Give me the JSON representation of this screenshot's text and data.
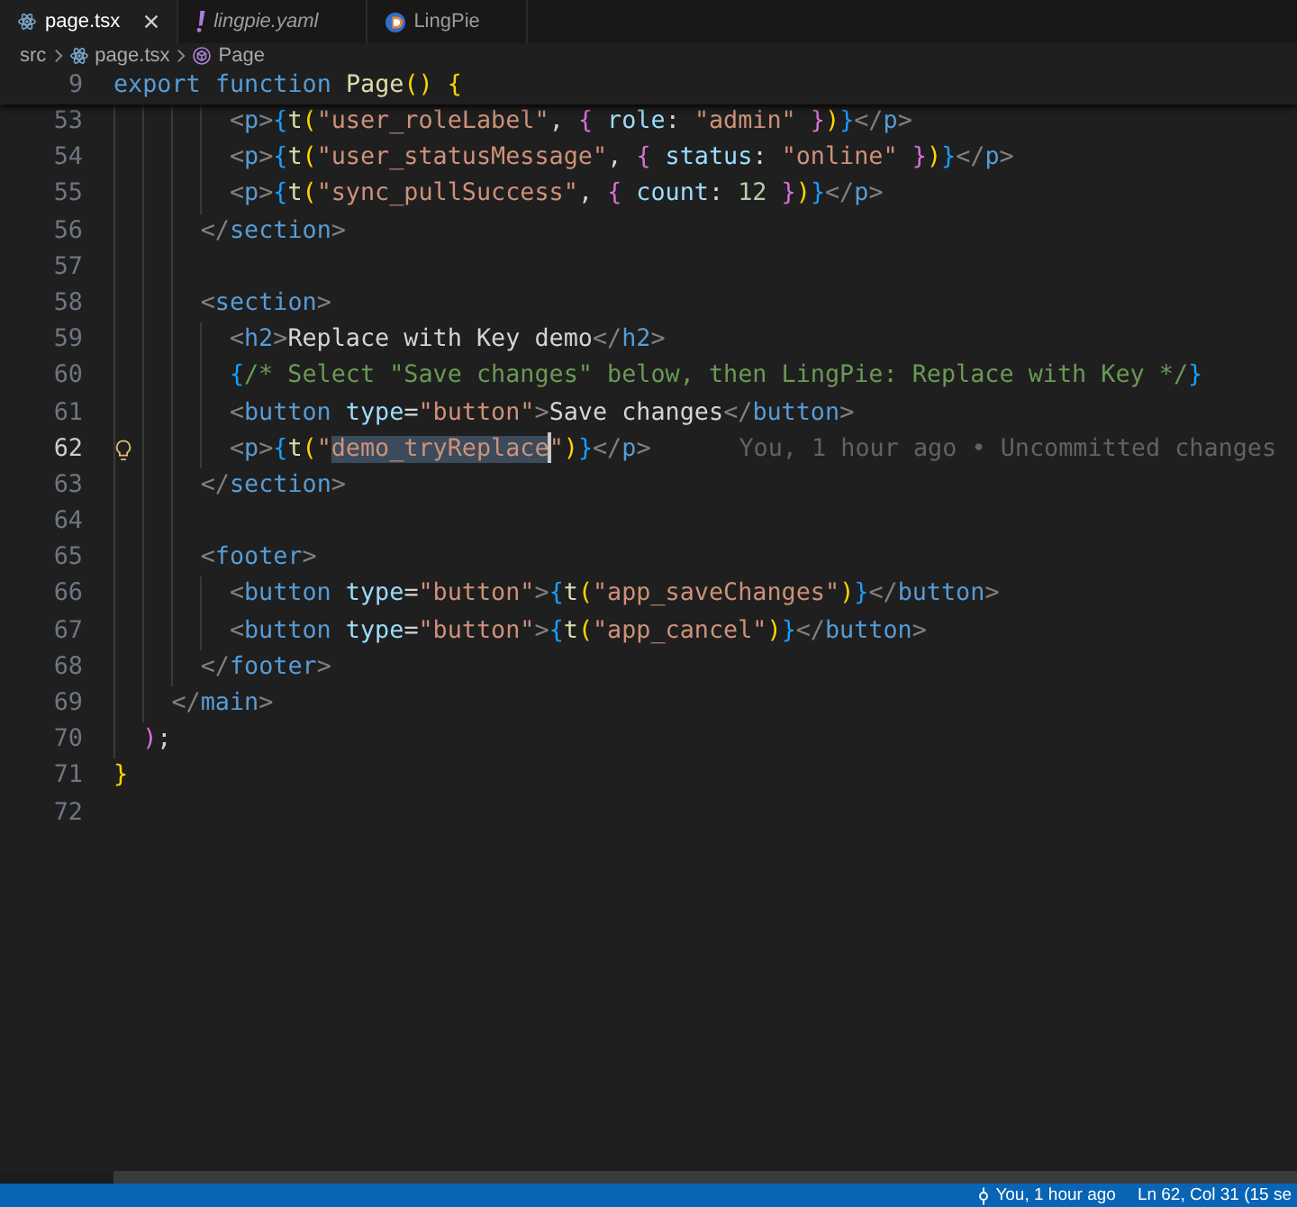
{
  "tabs": [
    {
      "label": "page.tsx",
      "kind": "tsx",
      "selected": true,
      "preview": false
    },
    {
      "label": "lingpie.yaml",
      "kind": "yaml",
      "selected": false,
      "preview": true
    },
    {
      "label": "LingPie",
      "kind": "extension",
      "selected": false,
      "preview": false
    }
  ],
  "breadcrumbs": [
    {
      "label": "src",
      "kind": "folder"
    },
    {
      "label": "page.tsx",
      "kind": "tsx"
    },
    {
      "label": "Page",
      "kind": "symbol"
    }
  ],
  "sticky_line": {
    "number": "9",
    "tokens": [
      {
        "text": "export ",
        "kind": "kw"
      },
      {
        "text": "function ",
        "kind": "kw"
      },
      {
        "text": "Page",
        "kind": "name"
      },
      {
        "text": "()",
        "kind": "b1"
      },
      {
        "text": " {",
        "kind": "b1"
      }
    ]
  },
  "lines": [
    {
      "number": "53",
      "current": false,
      "tokens": [
        {
          "text": "        <",
          "kind": "punct"
        },
        {
          "text": "p",
          "kind": "tag"
        },
        {
          "text": ">",
          "kind": "punct"
        },
        {
          "text": "{",
          "kind": "b3"
        },
        {
          "text": "t",
          "kind": "call"
        },
        {
          "text": "(",
          "kind": "b1"
        },
        {
          "text": "\"user_roleLabel\"",
          "kind": "str"
        },
        {
          "text": ", ",
          "kind": "plain"
        },
        {
          "text": "{",
          "kind": "b2"
        },
        {
          "text": " role",
          "kind": "prop"
        },
        {
          "text": ": ",
          "kind": "plain"
        },
        {
          "text": "\"admin\"",
          "kind": "str"
        },
        {
          "text": " }",
          "kind": "b2"
        },
        {
          "text": ")",
          "kind": "b1"
        },
        {
          "text": "}",
          "kind": "b3"
        },
        {
          "text": "</",
          "kind": "punct"
        },
        {
          "text": "p",
          "kind": "tag"
        },
        {
          "text": ">",
          "kind": "punct"
        }
      ]
    },
    {
      "number": "54",
      "current": false,
      "tokens": [
        {
          "text": "        <",
          "kind": "punct"
        },
        {
          "text": "p",
          "kind": "tag"
        },
        {
          "text": ">",
          "kind": "punct"
        },
        {
          "text": "{",
          "kind": "b3"
        },
        {
          "text": "t",
          "kind": "call"
        },
        {
          "text": "(",
          "kind": "b1"
        },
        {
          "text": "\"user_statusMessage\"",
          "kind": "str"
        },
        {
          "text": ", ",
          "kind": "plain"
        },
        {
          "text": "{",
          "kind": "b2"
        },
        {
          "text": " status",
          "kind": "prop"
        },
        {
          "text": ": ",
          "kind": "plain"
        },
        {
          "text": "\"online\"",
          "kind": "str"
        },
        {
          "text": " }",
          "kind": "b2"
        },
        {
          "text": ")",
          "kind": "b1"
        },
        {
          "text": "}",
          "kind": "b3"
        },
        {
          "text": "</",
          "kind": "punct"
        },
        {
          "text": "p",
          "kind": "tag"
        },
        {
          "text": ">",
          "kind": "punct"
        }
      ]
    },
    {
      "number": "55",
      "current": false,
      "tokens": [
        {
          "text": "        <",
          "kind": "punct"
        },
        {
          "text": "p",
          "kind": "tag"
        },
        {
          "text": ">",
          "kind": "punct"
        },
        {
          "text": "{",
          "kind": "b3"
        },
        {
          "text": "t",
          "kind": "call"
        },
        {
          "text": "(",
          "kind": "b1"
        },
        {
          "text": "\"sync_pullSuccess\"",
          "kind": "str"
        },
        {
          "text": ", ",
          "kind": "plain"
        },
        {
          "text": "{",
          "kind": "b2"
        },
        {
          "text": " count",
          "kind": "prop"
        },
        {
          "text": ": ",
          "kind": "plain"
        },
        {
          "text": "12",
          "kind": "num"
        },
        {
          "text": " }",
          "kind": "b2"
        },
        {
          "text": ")",
          "kind": "b1"
        },
        {
          "text": "}",
          "kind": "b3"
        },
        {
          "text": "</",
          "kind": "punct"
        },
        {
          "text": "p",
          "kind": "tag"
        },
        {
          "text": ">",
          "kind": "punct"
        }
      ]
    },
    {
      "number": "56",
      "current": false,
      "tokens": [
        {
          "text": "      </",
          "kind": "punct"
        },
        {
          "text": "section",
          "kind": "tag"
        },
        {
          "text": ">",
          "kind": "punct"
        }
      ]
    },
    {
      "number": "57",
      "current": false
    },
    {
      "number": "58",
      "current": false,
      "tokens": [
        {
          "text": "      <",
          "kind": "punct"
        },
        {
          "text": "section",
          "kind": "tag"
        },
        {
          "text": ">",
          "kind": "punct"
        }
      ]
    },
    {
      "number": "59",
      "current": false,
      "tokens": [
        {
          "text": "        <",
          "kind": "punct"
        },
        {
          "text": "h2",
          "kind": "tag"
        },
        {
          "text": ">",
          "kind": "punct"
        },
        {
          "text": "Replace with Key demo",
          "kind": "plain"
        },
        {
          "text": "</",
          "kind": "punct"
        },
        {
          "text": "h2",
          "kind": "tag"
        },
        {
          "text": ">",
          "kind": "punct"
        }
      ]
    },
    {
      "number": "60",
      "current": false,
      "tokens": [
        {
          "text": "        {",
          "kind": "b3"
        },
        {
          "text": "/* Select \"Save changes\" below, then LingPie: Replace with Key */",
          "kind": "comment"
        },
        {
          "text": "}",
          "kind": "b3"
        }
      ]
    },
    {
      "number": "61",
      "current": false,
      "tokens": [
        {
          "text": "        <",
          "kind": "punct"
        },
        {
          "text": "button",
          "kind": "tag"
        },
        {
          "text": " type",
          "kind": "prop"
        },
        {
          "text": "=",
          "kind": "plain"
        },
        {
          "text": "\"button\"",
          "kind": "str"
        },
        {
          "text": ">",
          "kind": "punct"
        },
        {
          "text": "Save changes",
          "kind": "plain"
        },
        {
          "text": "</",
          "kind": "punct"
        },
        {
          "text": "button",
          "kind": "tag"
        },
        {
          "text": ">",
          "kind": "punct"
        }
      ]
    },
    {
      "number": "62",
      "current": true,
      "tokens": [
        {
          "text": "        <",
          "kind": "punct"
        },
        {
          "text": "p",
          "kind": "tag"
        },
        {
          "text": ">",
          "kind": "punct"
        },
        {
          "text": "{",
          "kind": "b3"
        },
        {
          "text": "t",
          "kind": "call"
        },
        {
          "text": "(",
          "kind": "b1"
        },
        {
          "text": "\"",
          "kind": "str"
        }
      ],
      "selection": {
        "text": "demo_tryReplace",
        "kind": "str"
      },
      "tokens_after": [
        {
          "text": "\"",
          "kind": "str"
        },
        {
          "text": ")",
          "kind": "b1"
        },
        {
          "text": "}",
          "kind": "b3"
        },
        {
          "text": "</",
          "kind": "punct"
        },
        {
          "text": "p",
          "kind": "tag"
        },
        {
          "text": ">",
          "kind": "punct"
        }
      ],
      "blame": "You, 1 hour ago • Uncommitted changes"
    },
    {
      "number": "63",
      "current": false,
      "tokens": [
        {
          "text": "      </",
          "kind": "punct"
        },
        {
          "text": "section",
          "kind": "tag"
        },
        {
          "text": ">",
          "kind": "punct"
        }
      ]
    },
    {
      "number": "64",
      "current": false
    },
    {
      "number": "65",
      "current": false,
      "tokens": [
        {
          "text": "      <",
          "kind": "punct"
        },
        {
          "text": "footer",
          "kind": "tag"
        },
        {
          "text": ">",
          "kind": "punct"
        }
      ]
    },
    {
      "number": "66",
      "current": false,
      "tokens": [
        {
          "text": "        <",
          "kind": "punct"
        },
        {
          "text": "button",
          "kind": "tag"
        },
        {
          "text": " type",
          "kind": "prop"
        },
        {
          "text": "=",
          "kind": "plain"
        },
        {
          "text": "\"button\"",
          "kind": "str"
        },
        {
          "text": ">",
          "kind": "punct"
        },
        {
          "text": "{",
          "kind": "b3"
        },
        {
          "text": "t",
          "kind": "call"
        },
        {
          "text": "(",
          "kind": "b1"
        },
        {
          "text": "\"app_saveChanges\"",
          "kind": "str"
        },
        {
          "text": ")",
          "kind": "b1"
        },
        {
          "text": "}",
          "kind": "b3"
        },
        {
          "text": "</",
          "kind": "punct"
        },
        {
          "text": "button",
          "kind": "tag"
        },
        {
          "text": ">",
          "kind": "punct"
        }
      ]
    },
    {
      "number": "67",
      "current": false,
      "tokens": [
        {
          "text": "        <",
          "kind": "punct"
        },
        {
          "text": "button",
          "kind": "tag"
        },
        {
          "text": " type",
          "kind": "prop"
        },
        {
          "text": "=",
          "kind": "plain"
        },
        {
          "text": "\"button\"",
          "kind": "str"
        },
        {
          "text": ">",
          "kind": "punct"
        },
        {
          "text": "{",
          "kind": "b3"
        },
        {
          "text": "t",
          "kind": "call"
        },
        {
          "text": "(",
          "kind": "b1"
        },
        {
          "text": "\"app_cancel\"",
          "kind": "str"
        },
        {
          "text": ")",
          "kind": "b1"
        },
        {
          "text": "}",
          "kind": "b3"
        },
        {
          "text": "</",
          "kind": "punct"
        },
        {
          "text": "button",
          "kind": "tag"
        },
        {
          "text": ">",
          "kind": "punct"
        }
      ]
    },
    {
      "number": "68",
      "current": false,
      "tokens": [
        {
          "text": "      </",
          "kind": "punct"
        },
        {
          "text": "footer",
          "kind": "tag"
        },
        {
          "text": ">",
          "kind": "punct"
        }
      ]
    },
    {
      "number": "69",
      "current": false,
      "tokens": [
        {
          "text": "    </",
          "kind": "punct"
        },
        {
          "text": "main",
          "kind": "tag"
        },
        {
          "text": ">",
          "kind": "punct"
        }
      ]
    },
    {
      "number": "70",
      "current": false,
      "tokens": [
        {
          "text": "  )",
          "kind": "b2"
        },
        {
          "text": ";",
          "kind": "plain"
        }
      ]
    },
    {
      "number": "71",
      "current": false,
      "tokens": [
        {
          "text": "}",
          "kind": "b1"
        }
      ]
    },
    {
      "number": "72",
      "current": false
    }
  ],
  "status_bar": [
    {
      "kind": "blame",
      "label": "You, 1 hour ago"
    },
    {
      "kind": "position",
      "label": "Ln 62, Col 31 (15 se"
    }
  ]
}
